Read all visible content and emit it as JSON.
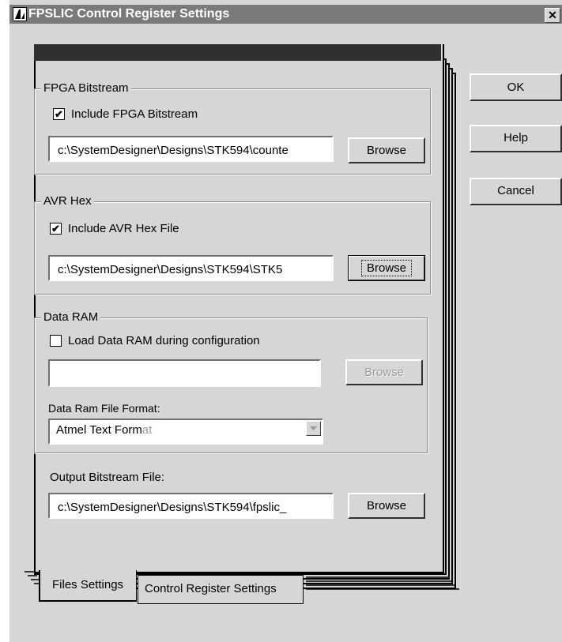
{
  "window": {
    "title": "FPSLIC Control Register Settings",
    "close_glyph": "✕"
  },
  "fpga_group": {
    "legend": "FPGA Bitstream",
    "checkbox_label": "Include FPGA Bitstream",
    "checked": true,
    "path": "c:\\SystemDesigner\\Designs\\STK594\\counte",
    "browse_label": "Browse"
  },
  "avr_group": {
    "legend": "AVR Hex",
    "checkbox_label": "Include AVR Hex File",
    "checked": true,
    "path": "c:\\SystemDesigner\\Designs\\STK594\\STK5",
    "browse_label": "Browse"
  },
  "data_ram_group": {
    "legend": "Data RAM",
    "checkbox_label": "Load Data RAM during configuration",
    "checked": false,
    "path": "",
    "browse_label": "Browse",
    "format_label": "Data Ram File Format:",
    "format_value_main": "Atmel Text Form",
    "format_value_dim": "at"
  },
  "output": {
    "label": "Output Bitstream File:",
    "path": "c:\\SystemDesigner\\Designs\\STK594\\fpslic_",
    "browse_label": "Browse"
  },
  "tabs": [
    {
      "label": "Files Settings",
      "active": true
    },
    {
      "label": "Control Register Settings",
      "active": false
    }
  ],
  "buttons": {
    "ok": "OK",
    "help": "Help",
    "cancel": "Cancel"
  },
  "icons": {
    "app": "fpslic-app-icon",
    "check": "✔",
    "dropdown": "chevron-down-icon"
  },
  "colors": {
    "face": "#d6d6d6",
    "titlebar": "#7a7a7a",
    "disabled_text": "#9a9a9a"
  }
}
